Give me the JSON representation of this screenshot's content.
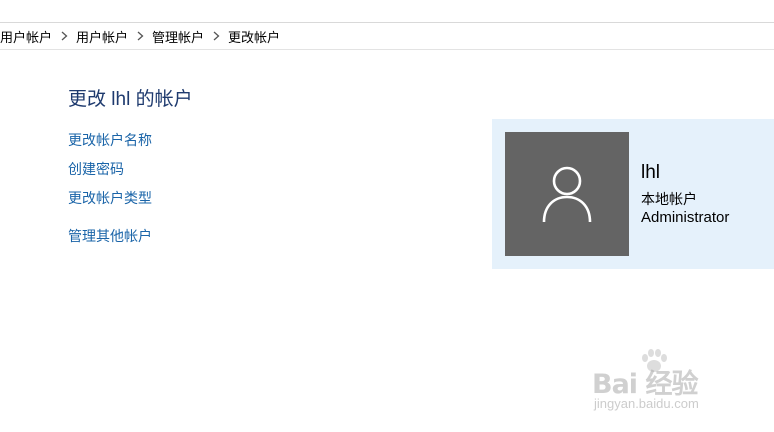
{
  "breadcrumb": {
    "items": [
      "用户帐户",
      "用户帐户",
      "管理帐户",
      "更改帐户"
    ]
  },
  "page": {
    "title": "更改 lhl 的帐户"
  },
  "tasks": {
    "change_name": "更改帐户名称",
    "create_password": "创建密码",
    "change_type": "更改帐户类型",
    "manage_other": "管理其他帐户"
  },
  "account": {
    "name": "lhl",
    "type": "本地帐户",
    "role": "Administrator",
    "avatar_icon": "user-silhouette-icon",
    "card_color": "#e5f1fb",
    "avatar_bg": "#646464"
  },
  "watermark": {
    "main": "Bai 经验",
    "sub": "jingyan.baidu.com"
  }
}
